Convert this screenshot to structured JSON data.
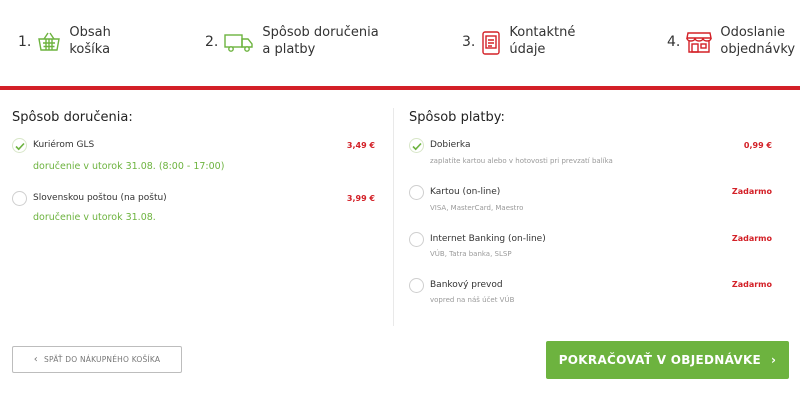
{
  "steps": [
    {
      "num": "1.",
      "line1": "Obsah",
      "line2": "košíka",
      "icon": "basket-icon"
    },
    {
      "num": "2.",
      "line1": "Spôsob doručenia",
      "line2": "a platby",
      "icon": "truck-icon"
    },
    {
      "num": "3.",
      "line1": "Kontaktné",
      "line2": "údaje",
      "icon": "contact-form-icon"
    },
    {
      "num": "4.",
      "line1": "Odoslanie",
      "line2": "objednávky",
      "icon": "shop-icon"
    }
  ],
  "colors": {
    "accent_red": "#d32027",
    "accent_green": "#6db33f"
  },
  "delivery": {
    "title": "Spôsob doručenia:",
    "options": [
      {
        "name": "Kuriérom GLS",
        "price": "3,49 €",
        "sub": "doručenie v utorok 31.08. (8:00 - 17:00)",
        "checked": true
      },
      {
        "name": "Slovenskou poštou (na poštu)",
        "price": "3,99 €",
        "sub": "doručenie v utorok 31.08.",
        "checked": false
      }
    ]
  },
  "payment": {
    "title": "Spôsob platby:",
    "options": [
      {
        "name": "Dobierka",
        "price": "0,99 €",
        "sub": "zaplatíte kartou alebo v hotovosti pri prevzatí balíka",
        "checked": true
      },
      {
        "name": "Kartou (on-line)",
        "price": "Zadarmo",
        "sub": "VISA, MasterCard, Maestro",
        "checked": false
      },
      {
        "name": "Internet Banking (on-line)",
        "price": "Zadarmo",
        "sub": "VÚB, Tatra banka, SLSP",
        "checked": false
      },
      {
        "name": "Bankový prevod",
        "price": "Zadarmo",
        "sub": "vopred na náš účet VÚB",
        "checked": false
      }
    ]
  },
  "buttons": {
    "back": "SPÄŤ DO NÁKUPNÉHO KOŠÍKA",
    "next": "POKRAČOVAŤ V OBJEDNÁVKE"
  }
}
